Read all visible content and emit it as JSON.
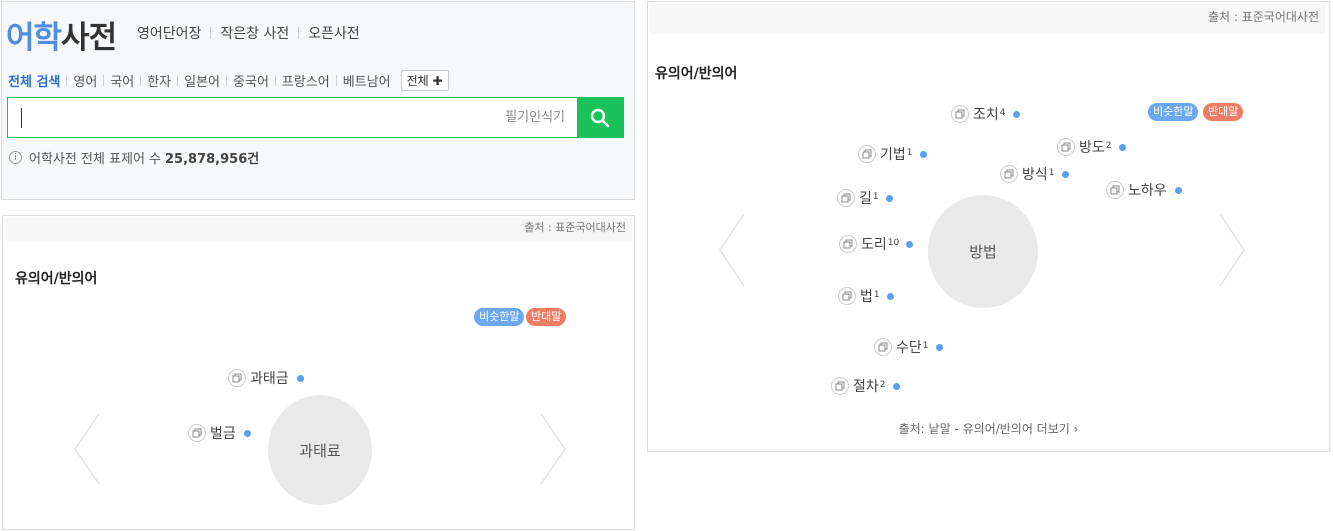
{
  "search_panel": {
    "logo_part1": "어학",
    "logo_part2": "사전",
    "top_nav": [
      "영어단어장",
      "작은창 사전",
      "오픈사전"
    ],
    "categories": [
      "전체 검색",
      "영어",
      "국어",
      "한자",
      "일본어",
      "중국어",
      "프랑스어",
      "베트남어"
    ],
    "category_all_button": "전체 ✚",
    "search_placeholder": "",
    "handwriting_label": "필기인식기",
    "info_text": "어학사전 전체 표제어 수",
    "info_count": "25,878,956건"
  },
  "panel_left": {
    "source": "출처 : 표준국어대사전",
    "title": "유의어/반의어",
    "badge_synonym": "비슷한말",
    "badge_antonym": "반대말",
    "center_word": "과태료",
    "words": [
      {
        "text": "과태금",
        "sup": ""
      },
      {
        "text": "벌금",
        "sup": ""
      }
    ]
  },
  "panel_right": {
    "source": "출처 : 표준국어대사전",
    "title": "유의어/반의어",
    "badge_synonym": "비슷한말",
    "badge_antonym": "반대말",
    "center_word": "방법",
    "words": [
      {
        "text": "조치",
        "sup": "4"
      },
      {
        "text": "기법",
        "sup": "1"
      },
      {
        "text": "방도",
        "sup": "2"
      },
      {
        "text": "방식",
        "sup": "1"
      },
      {
        "text": "노하우",
        "sup": ""
      },
      {
        "text": "길",
        "sup": "1"
      },
      {
        "text": "도리",
        "sup": "10"
      },
      {
        "text": "법",
        "sup": "1"
      },
      {
        "text": "수단",
        "sup": "1"
      },
      {
        "text": "절차",
        "sup": "2"
      }
    ],
    "more_link": "출처: 낱말 - 유의어/반의어 더보기 ›"
  }
}
